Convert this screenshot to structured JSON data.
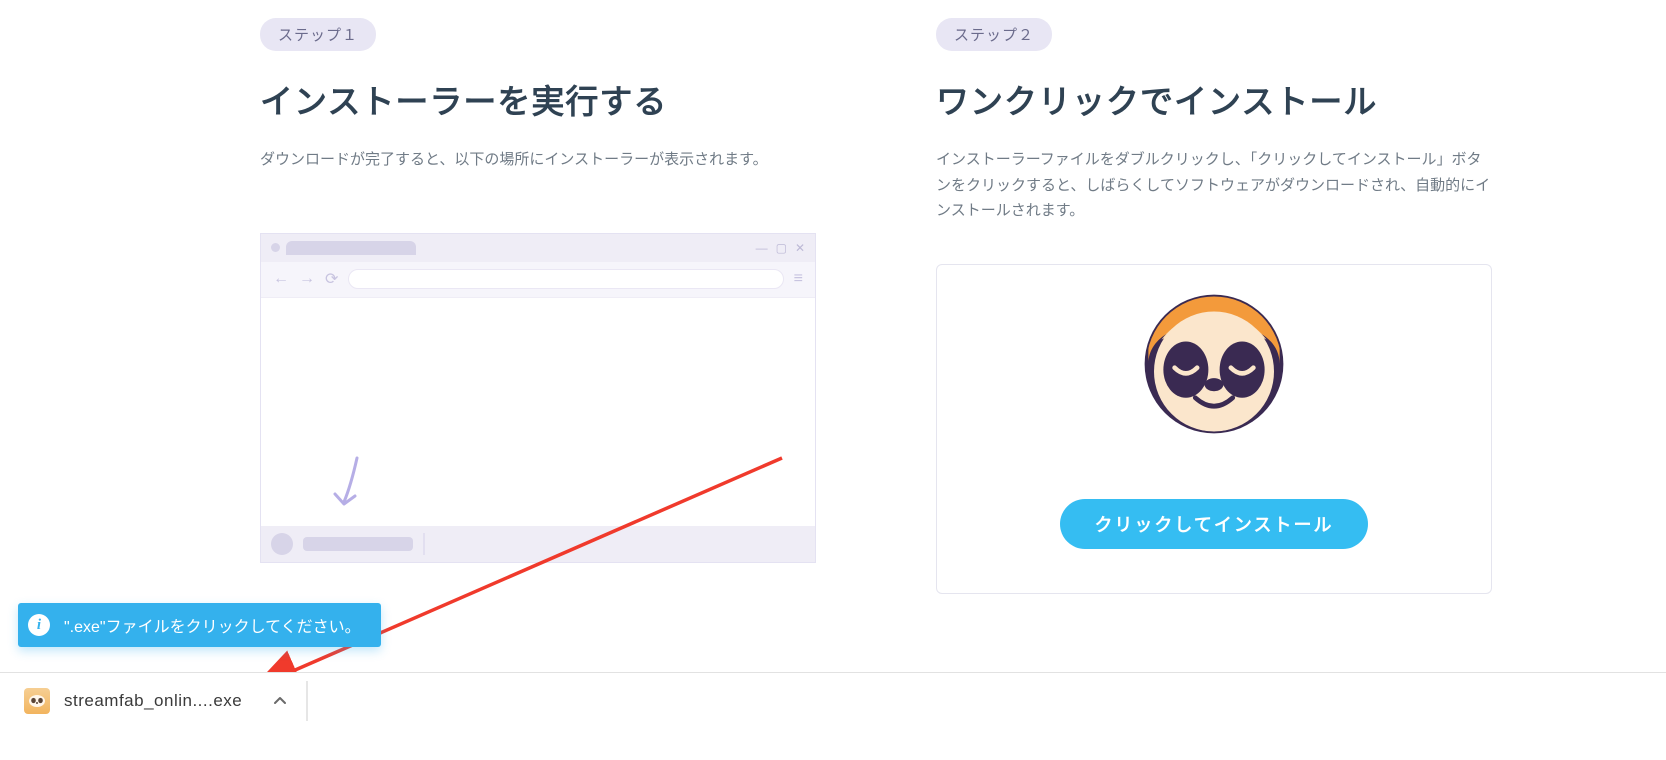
{
  "step1": {
    "badge": "ステップ１",
    "heading": "インストーラーを実行する",
    "desc": "ダウンロードが完了すると、以下の場所にインストーラーが表示されます。"
  },
  "step2": {
    "badge": "ステップ２",
    "heading": "ワンクリックでインストール",
    "desc": "インストーラーファイルをダブルクリックし、「クリックしてインストール」ボタンをクリックすると、しばらくしてソフトウェアがダウンロードされ、自動的にインストールされます。",
    "install_button": "クリックしてインストール"
  },
  "tooltip": {
    "text": "\".exe\"ファイルをクリックしてください。"
  },
  "download": {
    "filename": "streamfab_onlin....exe"
  },
  "icons": {
    "info": "i",
    "caret_up": "^"
  }
}
